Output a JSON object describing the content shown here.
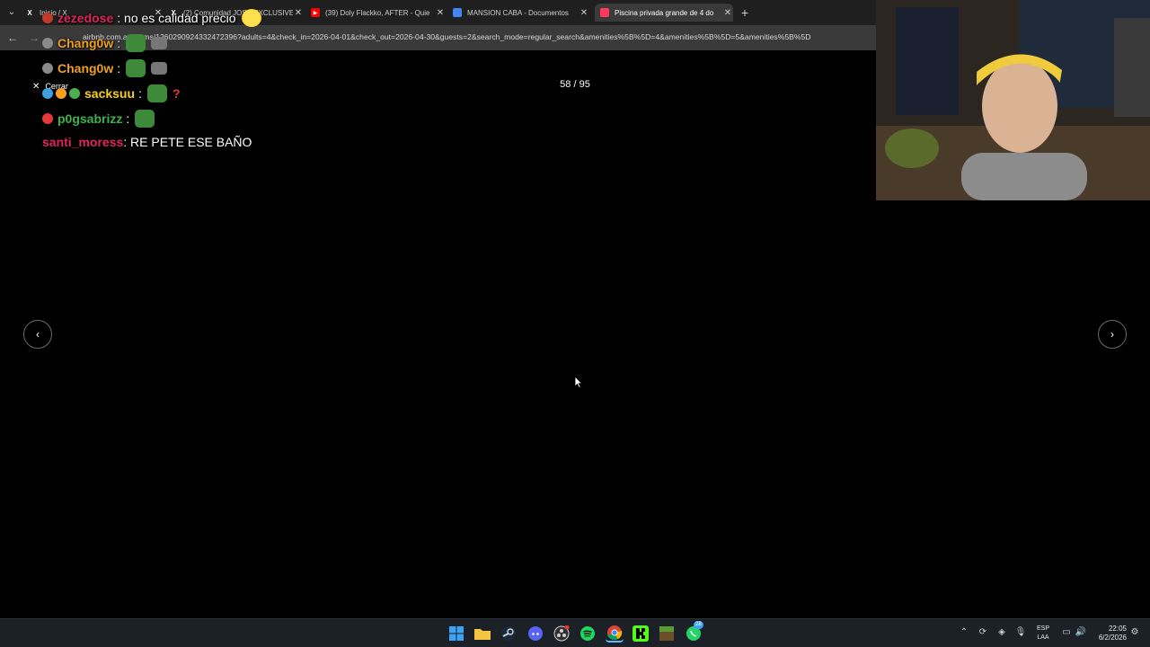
{
  "browser": {
    "tabs": [
      {
        "label": "Inicio / X",
        "icon": "x-logo-icon",
        "active": false
      },
      {
        "label": "(2) Comunidad JOSE EXCLUSIVE",
        "icon": "x-logo-icon",
        "active": false
      },
      {
        "label": "(39) Doly Flackko, AFTER - Quie",
        "icon": "youtube-icon",
        "active": false
      },
      {
        "label": "MANSION CABA - Documentos",
        "icon": "google-docs-icon",
        "active": false
      },
      {
        "label": "Piscina privada grande de 4 do",
        "icon": "airbnb-icon",
        "active": true
      }
    ],
    "url": "airbnb.com.ar/rooms/1260290924332472396?adults=4&check_in=2026-04-01&check_out=2026-04-30&guests=2&search_mode=regular_search&amenities%5B%5D=4&amenities%5B%5D=5&amenities%5B%5D"
  },
  "gallery": {
    "close_label": "Cerrar",
    "counter": "58 / 95",
    "prev_symbol": "‹",
    "next_symbol": "›"
  },
  "chat": [
    {
      "user": "zezedose",
      "message": ": no es calidad precio",
      "user_color": "#e0245e"
    },
    {
      "user": "Chang0w",
      "message": ":",
      "user_color": "#f0a020"
    },
    {
      "user": "Chang0w",
      "message": ":",
      "user_color": "#f0a020"
    },
    {
      "user": "sacksuu",
      "message": ":",
      "user_color": "#f5d020"
    },
    {
      "user": "p0gsabrizz",
      "message": ":",
      "user_color": "#3cb44b"
    },
    {
      "user": "santi_moress",
      "message": ": RE PETE ESE BAÑO",
      "user_color": "#e0245e"
    }
  ],
  "taskbar": {
    "apps": [
      "windows-start-icon",
      "file-explorer-icon",
      "steam-icon",
      "discord-icon",
      "obs-icon",
      "spotify-icon",
      "chrome-icon",
      "kick-icon",
      "minecraft-icon",
      "whatsapp-icon"
    ],
    "whatsapp_badge": "28",
    "language": "ESP",
    "language_sub": "LAA",
    "time": "22:05",
    "date": "6/2/2026"
  },
  "colors": {
    "accent_airbnb": "#ff385c",
    "chrome_tab_bg": "#1f1f1f",
    "chrome_active_tab": "#3a3a3a",
    "taskbar_bg": "#1c2027"
  }
}
